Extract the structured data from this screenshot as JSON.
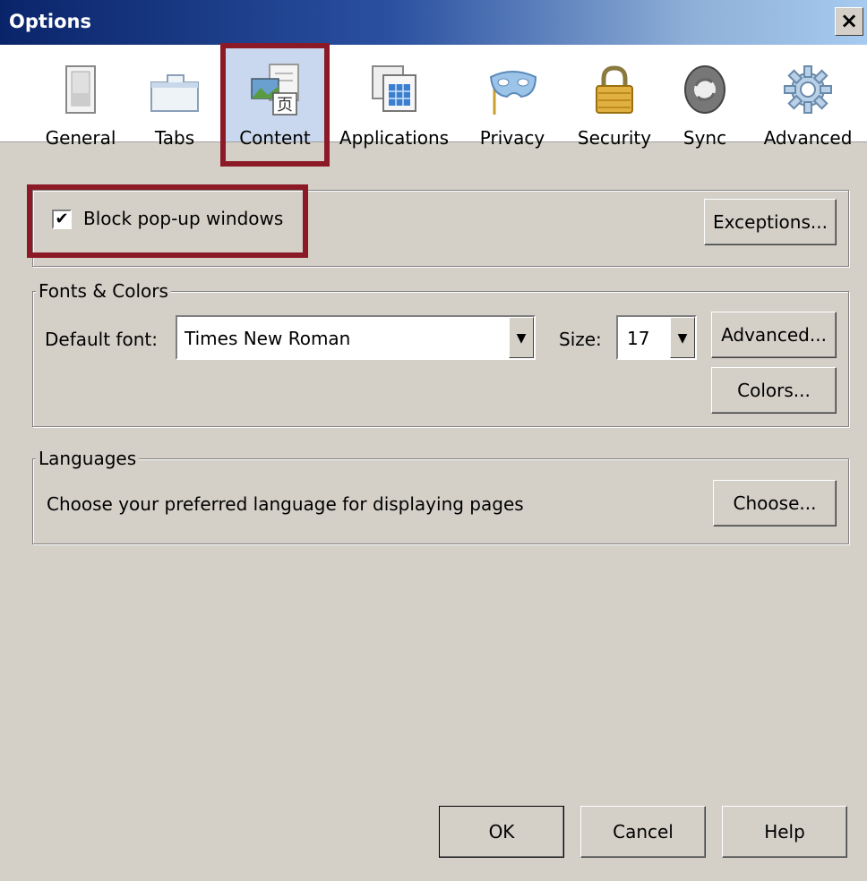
{
  "window": {
    "title": "Options",
    "close_glyph": "×"
  },
  "toolbar": {
    "items": [
      {
        "label": "General",
        "icon": "general-icon"
      },
      {
        "label": "Tabs",
        "icon": "tabs-icon"
      },
      {
        "label": "Content",
        "icon": "content-icon",
        "selected": true
      },
      {
        "label": "Applications",
        "icon": "applications-icon"
      },
      {
        "label": "Privacy",
        "icon": "privacy-mask-icon"
      },
      {
        "label": "Security",
        "icon": "padlock-icon"
      },
      {
        "label": "Sync",
        "icon": "sync-icon"
      },
      {
        "label": "Advanced",
        "icon": "gear-icon"
      }
    ]
  },
  "content": {
    "popup": {
      "label": "Block pop-up windows",
      "checked": true,
      "exceptions_label": "Exceptions..."
    },
    "fonts": {
      "legend": "Fonts & Colors",
      "default_font_label": "Default font:",
      "default_font_value": "Times New Roman",
      "size_label": "Size:",
      "size_value": "17",
      "advanced_label": "Advanced...",
      "colors_label": "Colors..."
    },
    "languages": {
      "legend": "Languages",
      "description": "Choose your preferred language for displaying pages",
      "choose_label": "Choose..."
    }
  },
  "footer": {
    "ok_label": "OK",
    "cancel_label": "Cancel",
    "help_label": "Help"
  },
  "colors": {
    "highlight": "#8b1a26",
    "titlebar": "#0a246a",
    "dialog_bg": "#d4d0c8"
  }
}
